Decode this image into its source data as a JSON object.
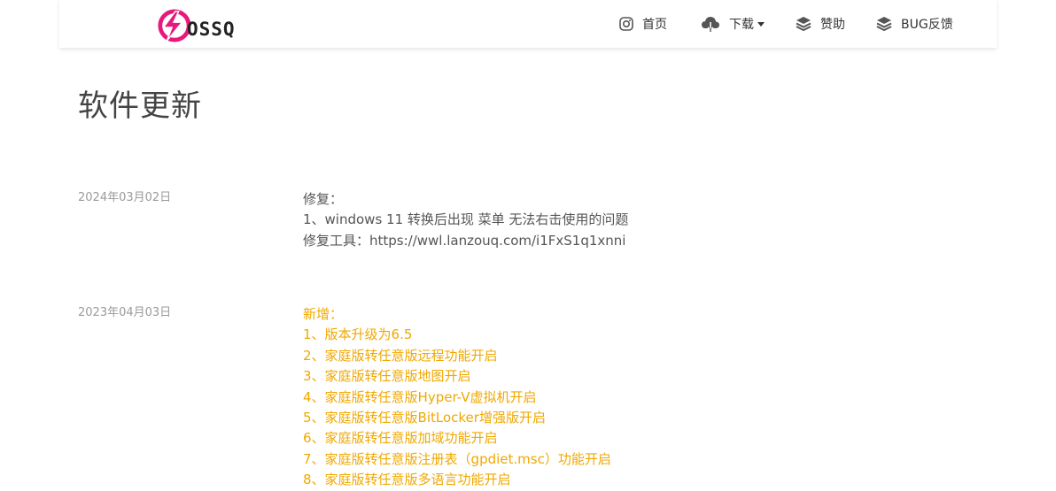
{
  "header": {
    "logo_text": "OSSQ",
    "nav": {
      "home": "首页",
      "download": "下载",
      "donate": "赞助",
      "bug": "BUG反馈"
    }
  },
  "page": {
    "title": "软件更新"
  },
  "entries": [
    {
      "date": "2024年03月02日",
      "lines": [
        "修复：",
        "1、windows 11 转换后出现 菜单 无法右击使用的问题",
        "修复工具：https://wwl.lanzouq.com/i1FxS1q1xnni"
      ]
    },
    {
      "date": "2023年04月03日",
      "lines": [
        "新增：",
        "1、版本升级为6.5",
        "2、家庭版转任意版远程功能开启",
        "3、家庭版转任意版地图开启",
        "4、家庭版转任意版Hyper-V虚拟机开启",
        "5、家庭版转任意版BitLocker增强版开启",
        "6、家庭版转任意版加域功能开启",
        "7、家庭版转任意版注册表（gpdiet.msc）功能开启",
        "8、家庭版转任意版多语言功能开启"
      ]
    }
  ],
  "colors": {
    "accent_new": "#f0a800",
    "logo_magenta": "#e8197d",
    "date_gray": "#9a9a9a"
  },
  "icons": {
    "home": "instagram-icon",
    "download": "cloud-download-icon",
    "donate": "layers-icon",
    "bug": "layers-icon"
  }
}
